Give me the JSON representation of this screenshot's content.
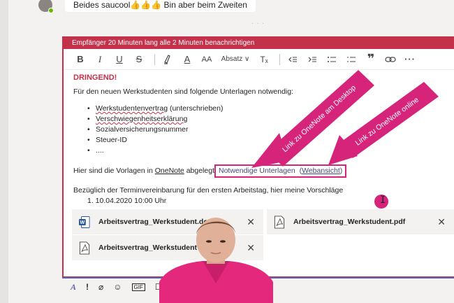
{
  "chat": {
    "message": "Beides saucool👍👍👍 Bin aber beim Zweiten"
  },
  "composer": {
    "banner": "Empfänger 20 Minuten lang alle 2 Minuten benachrichtigen",
    "toolbar": {
      "bold": "B",
      "italic": "I",
      "underline": "U",
      "strike": "S",
      "highlight": "A",
      "fontcolor": "A",
      "fontsize": "AA",
      "paragraph": "Absatz ∨",
      "clear": "Tₓ",
      "quote": "❞",
      "more": "···"
    },
    "urgent": "DRINGEND!",
    "intro": "Für den neuen Werkstudenten sind folgende Unterlagen notwendig:",
    "bullets": [
      {
        "a": "Werkstudentenvertrag",
        "b": " (unterschrieben)"
      },
      {
        "a": "Verschwiegenheitserklärung",
        "b": ""
      },
      {
        "a": "Sozialversicherungsnummer",
        "b": ""
      },
      {
        "a": "Steuer-ID",
        "b": ""
      },
      {
        "a": "....",
        "b": ""
      }
    ],
    "vorlagen_prefix": "Hier sind die Vorlagen in ",
    "vorlagen_onenote": "OneNote",
    "vorlagen_suffix": " abgelegt",
    "link_desktop": "Notwendige Unterlagen",
    "link_web_open": "(",
    "link_web": "Webansicht",
    "link_web_close": ")",
    "termin": "Bezüglich der Terminvereinbarung für den ersten Arbeitstag, hier meine Vorschläge",
    "numbered_item": "1.  10.04.2020 10:00 Uhr"
  },
  "annotations": {
    "arrow1": "Link zu OneNote am Desktop",
    "arrow2": "Link zu OneNote online"
  },
  "attachments": [
    {
      "name": "Arbeitsvertrag_Werkstudent.do",
      "icon": "word-icon"
    },
    {
      "name": "Arbeitsvertrag_Werkstudent.pdf",
      "icon": "pdf-icon"
    },
    {
      "name": "Arbeitsvertrag_Werkstudent",
      "icon": "pdf-icon"
    }
  ],
  "colors": {
    "accent": "#c4314b",
    "annotation": "#d6247b",
    "teams": "#6264a7"
  }
}
